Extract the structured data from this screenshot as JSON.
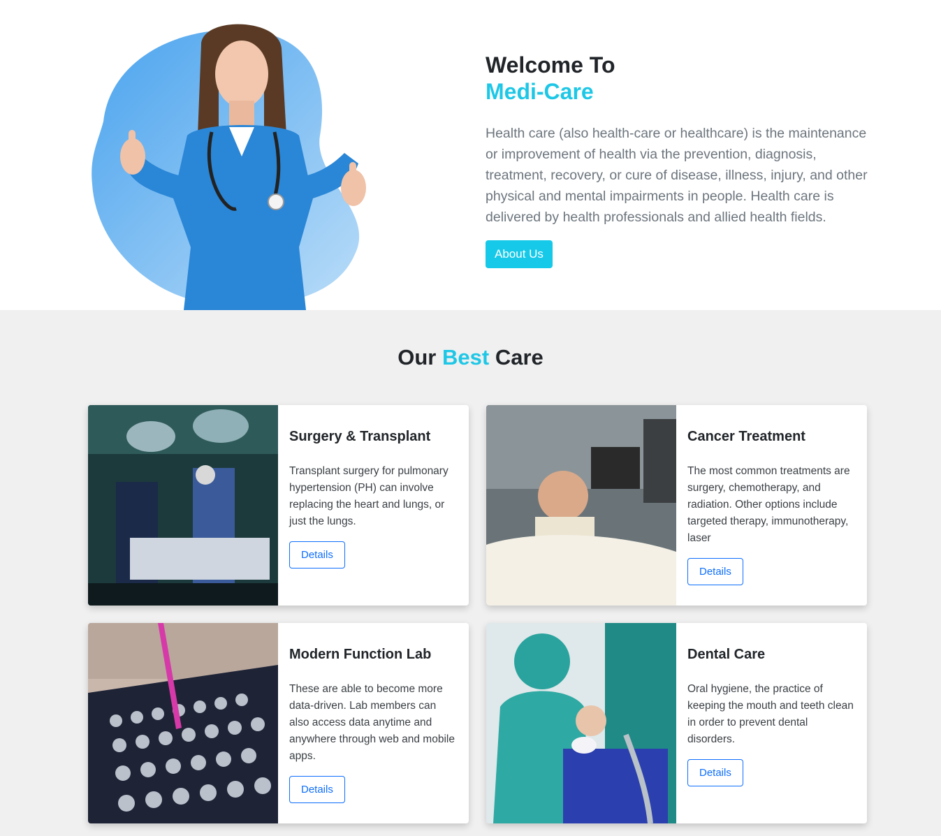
{
  "hero": {
    "title": "Welcome To",
    "brand": "Medi-Care",
    "description": "Health care (also health-care or healthcare) is the maintenance or improvement of health via the prevention, diagnosis, treatment, recovery, or cure of disease, illness, injury, and other physical and mental impairments in people. Health care is delivered by health professionals and allied health fields.",
    "button_label": "About Us"
  },
  "services": {
    "title_pre": "Our",
    "title_accent": "Best",
    "title_post": "Care",
    "cards": [
      {
        "title": "Surgery & Transplant",
        "text": "Transplant surgery for pulmonary hypertension (PH) can involve replacing the heart and lungs, or just the lungs.",
        "button": "Details",
        "image": "surgery-room-photo"
      },
      {
        "title": "Cancer Treatment",
        "text": "The most common treatments are surgery, chemotherapy, and radiation. Other options include targeted therapy, immunotherapy, laser",
        "button": "Details",
        "image": "child-patient-photo"
      },
      {
        "title": "Modern Function Lab",
        "text": "These are able to become more data-driven. Lab members can also access data anytime and anywhere through web and mobile apps.",
        "button": "Details",
        "image": "lab-tubes-photo"
      },
      {
        "title": "Dental Care",
        "text": "Oral hygiene, the practice of keeping the mouth and teeth clean in order to prevent dental disorders.",
        "button": "Details",
        "image": "dentist-photo"
      }
    ]
  },
  "colors": {
    "accent": "#1ec7e6",
    "button": "#17c9e8",
    "details": "#0d6efd"
  }
}
